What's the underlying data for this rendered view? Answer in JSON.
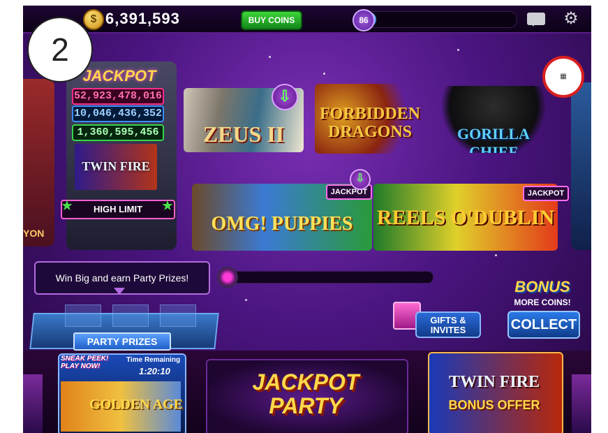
{
  "step_badge": "2",
  "topbar": {
    "coin_icon": "coin-icon",
    "coin_symbol": "$",
    "balance": "6,391,593",
    "buy_coins_label": "BUY COINS",
    "level": "86",
    "level_progress": 0.12
  },
  "featured_machine": {
    "jackpot_label": "JACKPOT",
    "jackpots": [
      "52,923,478,016",
      "10,046,436,352",
      "1,360,595,456"
    ],
    "game": "TWIN FIRE",
    "badge": "HIGH LIMIT"
  },
  "left_machine_label": "YON",
  "games": [
    {
      "id": "zeus",
      "name": "ZEUS II"
    },
    {
      "id": "dragons",
      "name": "FORBIDDEN DRAGONS"
    },
    {
      "id": "gorilla",
      "name": "GORILLA CHIEF"
    },
    {
      "id": "puppies",
      "name": "OMG! PUPPIES",
      "tag": "JACKPOT"
    },
    {
      "id": "dublin",
      "name": "REELS O'DUBLIN",
      "tag": "JACKPOT"
    }
  ],
  "party": {
    "tooltip": "Win Big and earn Party Prizes!",
    "progress": 0.02,
    "prizes_label": "PARTY PRIZES"
  },
  "gifts_label": "GIFTS & INVITES",
  "bonus": {
    "title": "BONUS",
    "subtitle": "MORE COINS!",
    "collect_label": "COLLECT"
  },
  "bottom": {
    "sneak_peek": "SNEAK PEEK! PLAY NOW!",
    "time_label": "Time Remaining",
    "time_value": "1:20:10",
    "golden_game": "GOLDEN AGE",
    "jackpot_party": "JACKPOT PARTY",
    "twinfire_title": "TWIN FIRE",
    "twinfire_offer": "BONUS OFFER"
  },
  "colors": {
    "background": "#4a1580",
    "accent_pink": "#ff5fd1",
    "buy_green": "#12861a",
    "collect_blue": "#2a7ae8"
  }
}
